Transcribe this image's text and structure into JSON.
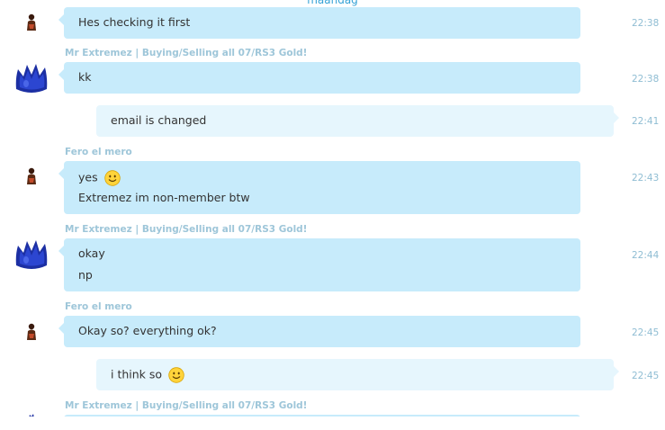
{
  "day_label": "maandag",
  "messages": [
    {
      "sender": "",
      "lines": [
        "Hes checking it first"
      ],
      "time": "22:38"
    },
    {
      "sender": "Mr Extremez | Buying/Selling all 07/RS3 Gold!",
      "lines": [
        "kk"
      ],
      "time": "22:38"
    },
    {
      "sender": "",
      "lines": [
        "email is changed"
      ],
      "time": "22:41"
    },
    {
      "sender": "Fero el mero",
      "lines": [
        "yes",
        "Extremez im non-member btw"
      ],
      "time": "22:43"
    },
    {
      "sender": "Mr Extremez | Buying/Selling all 07/RS3 Gold!",
      "lines": [
        "okay",
        "np"
      ],
      "time": "22:44"
    },
    {
      "sender": "Fero el mero",
      "lines": [
        "Okay so? everything ok?"
      ],
      "time": "22:45"
    },
    {
      "sender": "",
      "lines": [
        "i think so"
      ],
      "time": "22:45"
    },
    {
      "sender": "Mr Extremez | Buying/Selling all 07/RS3 Gold!",
      "lines": [],
      "time": ""
    }
  ],
  "icons": {
    "small_avatar": "person-avatar-icon",
    "big_avatar": "blue-crown-avatar-icon",
    "emoji": "smiley-emoji-icon"
  },
  "colors": {
    "incoming_bubble": "#c7ebfb",
    "outgoing_bubble": "#e6f6fd",
    "sender_name": "#9ec6d9",
    "timestamp": "#8fbdd3",
    "day_label": "#35a2d6"
  }
}
